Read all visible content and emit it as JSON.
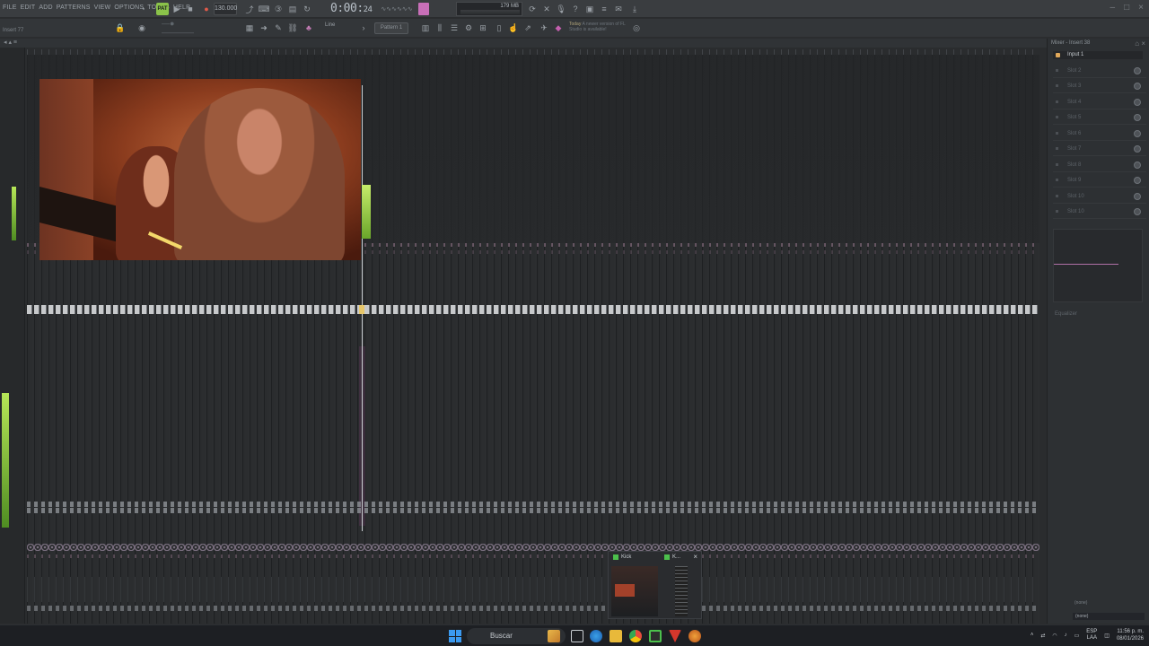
{
  "menu": [
    "FILE",
    "EDIT",
    "ADD",
    "PATTERNS",
    "VIEW",
    "OPTIONS",
    "TOOLS",
    "HELP"
  ],
  "transport": {
    "mode_label": "PAT",
    "tempo": "130.000",
    "time_main": "0:00",
    "time_sub": "24"
  },
  "cpu": {
    "memory": "179 MB",
    "voices": "0"
  },
  "hint": "Insert 77",
  "toolbar2": {
    "snap": "Line",
    "pattern": "Pattern 1"
  },
  "news": {
    "lead": "Today",
    "text": "A newer version of FL Studio is available!"
  },
  "rpanel": {
    "title": "Mixer - Insert 38",
    "input": "Input 1",
    "slots": [
      "Slot 2",
      "Slot 3",
      "Slot 4",
      "Slot 5",
      "Slot 6",
      "Slot 7",
      "Slot 8",
      "Slot 9",
      "Slot 10",
      "Slot 10"
    ],
    "eq_label": "Equalizer",
    "out_label": "(none)",
    "out_value": "(none)"
  },
  "preview": {
    "window1": "Kick",
    "window2": "K..."
  },
  "taskbar": {
    "search_label": "Buscar",
    "lang_top": "ESP",
    "lang_bottom": "LAA",
    "time": "11:56 p. m.",
    "date": "08/01/2026"
  }
}
